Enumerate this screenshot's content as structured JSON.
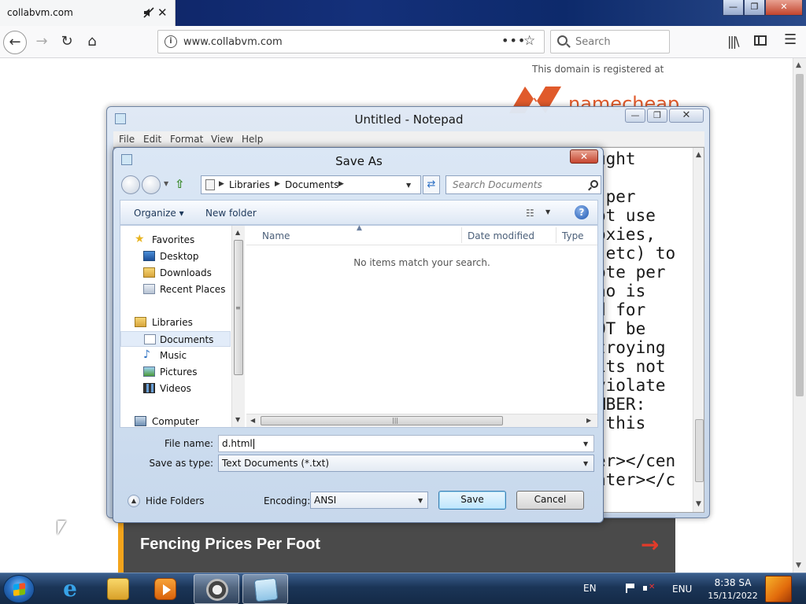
{
  "browser": {
    "tab_title": "collabvm.com",
    "url": "www.collabvm.com",
    "url_more": "•••",
    "search_placeholder": "Search",
    "tab_close": "✕",
    "win_min": "—",
    "win_max": "❐",
    "win_close": "✕"
  },
  "page": {
    "domain_note": "This domain is registered at",
    "brand": "namecheap",
    "fence_link": "Fencing Prices Per Foot",
    "fence_arrow": "→",
    "brand_color": "#e05a2b",
    "accent_color": "#f3a41b"
  },
  "notepad": {
    "title": "Untitled - Notepad",
    "menu": [
      "File",
      "Edit",
      "Format",
      "View",
      "Help"
    ],
    "visible_text": "ught\n\n per\not use\noxies,\n etc) to\note per\nho is\nd for\nOT be\ntroying\nits not\nviolate\nMBER:\n this\n\ner></cen\nnter></c"
  },
  "save_as": {
    "title": "Save As",
    "breadcrumb": [
      "Libraries",
      "Documents"
    ],
    "search_placeholder": "Search Documents",
    "organize_label": "Organize",
    "new_folder_label": "New folder",
    "help_label": "?",
    "nav_tree": [
      {
        "label": "Favorites",
        "icon": "star-icon"
      },
      {
        "label": "Desktop",
        "icon": "desktop-icon"
      },
      {
        "label": "Downloads",
        "icon": "downloads-folder-icon"
      },
      {
        "label": "Recent Places",
        "icon": "recent-places-icon"
      },
      {
        "label": "Libraries",
        "icon": "libraries-icon"
      },
      {
        "label": "Documents",
        "icon": "documents-icon",
        "selected": true
      },
      {
        "label": "Music",
        "icon": "music-icon"
      },
      {
        "label": "Pictures",
        "icon": "pictures-icon"
      },
      {
        "label": "Videos",
        "icon": "videos-icon"
      },
      {
        "label": "Computer",
        "icon": "computer-icon"
      }
    ],
    "columns": [
      "Name",
      "Date modified",
      "Type"
    ],
    "empty_message": "No items match your search.",
    "file_name_label": "File name:",
    "file_name_value": "d.html",
    "save_as_type_label": "Save as type:",
    "save_as_type_value": "Text Documents (*.txt)",
    "hide_folders_label": "Hide Folders",
    "encoding_label": "Encoding:",
    "encoding_value": "ANSI",
    "save_label": "Save",
    "cancel_label": "Cancel"
  },
  "taskbar": {
    "apps": [
      "internet-explorer",
      "windows-explorer",
      "media-player",
      "collabvm-raccoon",
      "notepad"
    ],
    "input_lang": "EN",
    "keyboard_lang": "ENU",
    "time": "8:38 SA",
    "date": "15/11/2022"
  }
}
